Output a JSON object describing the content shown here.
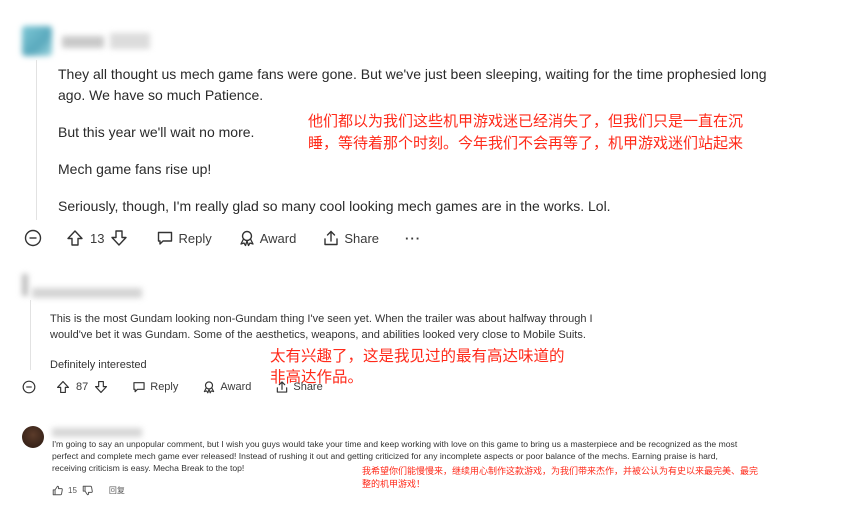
{
  "comment1": {
    "paragraphs": [
      "They all thought us mech game fans were gone. But we've just been sleeping, waiting for the time prophesied long ago. We have so much Patience.",
      "But this year we'll wait no more.",
      "Mech game fans rise up!",
      "Seriously, though, I'm really glad so many cool looking mech games are in the works. Lol."
    ],
    "translation": "他们都以为我们这些机甲游戏迷已经消失了，但我们只是一直在沉睡，等待着那个时刻。今年我们不会再等了，机甲游戏迷们站起来",
    "votes": "13",
    "reply_label": "Reply",
    "award_label": "Award",
    "share_label": "Share",
    "more_label": "···"
  },
  "comment2": {
    "paragraphs": [
      "This is the most Gundam looking non-Gundam thing I've seen yet. When the trailer was about halfway through I would've bet it was Gundam. Some of the aesthetics, weapons, and abilities looked very close to Mobile Suits.",
      "Definitely interested"
    ],
    "translation_line1": "太有兴趣了，这是我见过的最有高达味道的",
    "translation_line2": "非高达作品。",
    "votes": "87",
    "reply_label": "Reply",
    "award_label": "Award",
    "share_label": "Share"
  },
  "comment3": {
    "text": "I'm going to say an unpopular comment, but I wish you guys would take your time and keep working with love on this game to bring us a masterpiece and be recognized as the most perfect and complete mech game ever released! Instead of rushing it out and getting criticized for any incomplete aspects or poor balance of the mechs. Earning praise is hard, receiving criticism is easy. Mecha Break to the top!",
    "translation": "我希望你们能慢慢来，继续用心制作这款游戏，为我们带来杰作，并被公认为有史以来最完美、最完整的机甲游戏！",
    "votes": "15",
    "reply_label": "回复"
  },
  "colors": {
    "annotation": "#ff2a1a",
    "text": "#2a2a2a"
  }
}
